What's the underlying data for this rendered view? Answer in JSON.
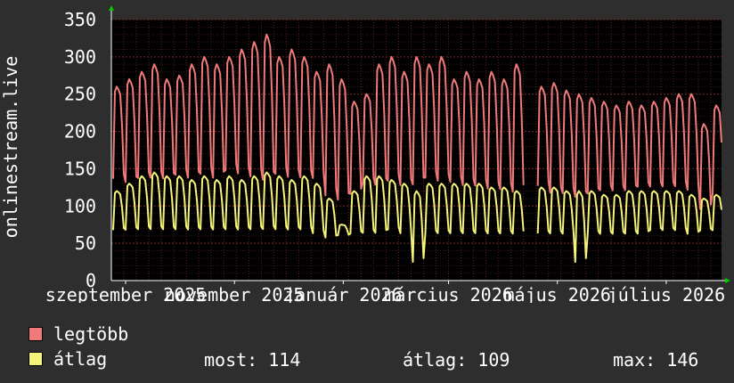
{
  "chart_data": {
    "type": "line",
    "ylabel": "onlinestream.live",
    "ylim": [
      0,
      350
    ],
    "yticks": [
      0,
      50,
      100,
      150,
      200,
      250,
      300,
      350
    ],
    "xticks": [
      "szeptember 2025",
      "november 2025",
      "január 2026",
      "március 2026",
      "május 2026",
      "július 2026"
    ],
    "x_range": [
      "2025-08-24",
      "2026-08-01"
    ],
    "grid": true,
    "background": "#000000",
    "colors": {
      "legtöbb": "#f07a7a",
      "átlag": "#f4f47a"
    },
    "weekly": {
      "x": [
        "2025-08-25",
        "2025-09-01",
        "2025-09-08",
        "2025-09-15",
        "2025-09-22",
        "2025-09-29",
        "2025-10-06",
        "2025-10-13",
        "2025-10-20",
        "2025-10-27",
        "2025-11-03",
        "2025-11-10",
        "2025-11-17",
        "2025-11-24",
        "2025-12-01",
        "2025-12-08",
        "2025-12-15",
        "2025-12-22",
        "2025-12-29",
        "2026-01-05",
        "2026-01-12",
        "2026-01-19",
        "2026-01-26",
        "2026-02-02",
        "2026-02-09",
        "2026-02-16",
        "2026-02-23",
        "2026-03-02",
        "2026-03-09",
        "2026-03-16",
        "2026-03-23",
        "2026-03-30",
        "2026-04-06",
        "2026-04-13",
        "2026-04-20",
        "2026-04-27",
        "2026-05-04",
        "2026-05-11",
        "2026-05-18",
        "2026-05-25",
        "2026-06-01",
        "2026-06-08",
        "2026-06-15",
        "2026-06-22",
        "2026-06-29",
        "2026-07-06",
        "2026-07-13",
        "2026-07-20",
        "2026-07-27"
      ],
      "series": [
        {
          "name": "legtöbb",
          "peak": [
            260,
            270,
            280,
            290,
            270,
            275,
            290,
            300,
            290,
            300,
            310,
            320,
            330,
            300,
            310,
            300,
            280,
            290,
            270,
            240,
            250,
            290,
            300,
            280,
            300,
            290,
            300,
            270,
            280,
            270,
            280,
            270,
            290,
            0,
            260,
            265,
            255,
            250,
            245,
            240,
            235,
            240,
            235,
            240,
            245,
            250,
            250,
            210,
            235
          ],
          "low": [
            130,
            125,
            130,
            130,
            130,
            135,
            130,
            135,
            130,
            140,
            135,
            130,
            125,
            135,
            130,
            130,
            130,
            105,
            100,
            110,
            125,
            120,
            125,
            120,
            120,
            130,
            125,
            125,
            120,
            120,
            115,
            115,
            110,
            0,
            120,
            110,
            110,
            105,
            110,
            115,
            115,
            115,
            120,
            120,
            120,
            120,
            115,
            90,
            110
          ]
        },
        {
          "name": "átlag",
          "peak": [
            120,
            130,
            140,
            145,
            140,
            140,
            135,
            140,
            135,
            140,
            135,
            140,
            145,
            140,
            135,
            140,
            130,
            110,
            75,
            120,
            140,
            140,
            135,
            130,
            120,
            130,
            130,
            130,
            130,
            130,
            125,
            125,
            120,
            0,
            125,
            125,
            120,
            120,
            120,
            115,
            115,
            120,
            120,
            120,
            120,
            120,
            115,
            110,
            115
          ],
          "low": [
            65,
            65,
            65,
            65,
            65,
            65,
            65,
            65,
            65,
            65,
            65,
            65,
            65,
            65,
            65,
            65,
            60,
            55,
            60,
            60,
            60,
            60,
            65,
            60,
            20,
            60,
            60,
            60,
            60,
            60,
            60,
            60,
            60,
            0,
            60,
            60,
            60,
            20,
            60,
            60,
            60,
            60,
            60,
            65,
            65,
            65,
            60,
            65,
            65
          ]
        }
      ]
    }
  },
  "legend": {
    "max_label": "legtöbb",
    "avg_label": "átlag",
    "now_label": "most:",
    "now_value": "114",
    "mean_label": "átlag:",
    "mean_value": "109",
    "max_stat_label": "max:",
    "max_value": "146"
  }
}
